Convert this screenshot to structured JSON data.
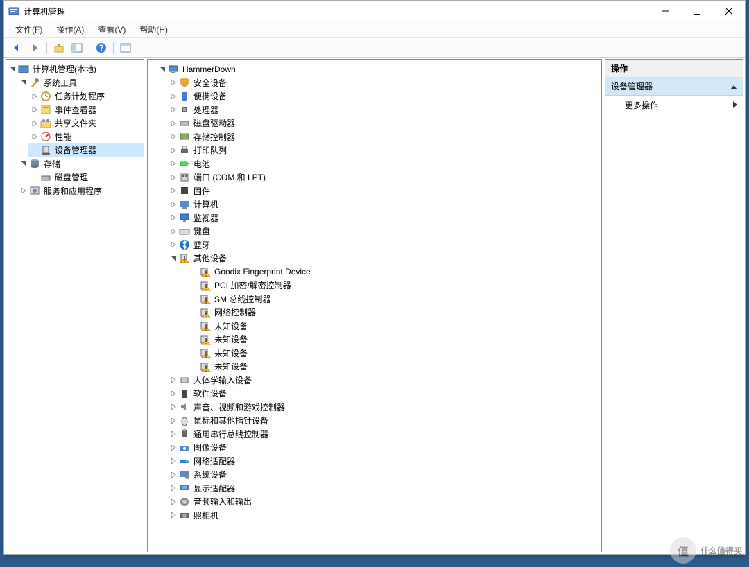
{
  "window": {
    "title": "计算机管理"
  },
  "menu": {
    "file": "文件(F)",
    "action": "操作(A)",
    "view": "查看(V)",
    "help": "帮助(H)"
  },
  "left_tree": {
    "root": "计算机管理(本地)",
    "system_tools": "系统工具",
    "task_scheduler": "任务计划程序",
    "event_viewer": "事件查看器",
    "shared_folders": "共享文件夹",
    "performance": "性能",
    "device_manager": "设备管理器",
    "storage": "存储",
    "disk_mgmt": "磁盘管理",
    "services_apps": "服务和应用程序"
  },
  "center_tree": {
    "root": "HammerDown",
    "security_devices": "安全设备",
    "portable_devices": "便携设备",
    "processors": "处理器",
    "disk_drives": "磁盘驱动器",
    "storage_controllers": "存储控制器",
    "print_queues": "打印队列",
    "batteries": "电池",
    "ports": "端口 (COM 和 LPT)",
    "firmware": "固件",
    "computer": "计算机",
    "monitors": "监视器",
    "keyboards": "键盘",
    "bluetooth": "蓝牙",
    "other_devices": "其他设备",
    "goodix": "Goodix Fingerprint Device",
    "pci_crypto": "PCI 加密/解密控制器",
    "sm_bus": "SM 总线控制器",
    "net_controller": "网络控制器",
    "unknown1": "未知设备",
    "unknown2": "未知设备",
    "unknown3": "未知设备",
    "unknown4": "未知设备",
    "hid": "人体学输入设备",
    "software_devices": "软件设备",
    "sound_video_game": "声音、视频和游戏控制器",
    "mice": "鼠标和其他指针设备",
    "usb": "通用串行总线控制器",
    "imaging": "图像设备",
    "network_adapters": "网络适配器",
    "system_devices": "系统设备",
    "display_adapters": "显示适配器",
    "audio_io": "音频输入和输出",
    "cameras": "照相机"
  },
  "actions": {
    "header": "操作",
    "section": "设备管理器",
    "more": "更多操作"
  },
  "watermark": "什么值得买"
}
